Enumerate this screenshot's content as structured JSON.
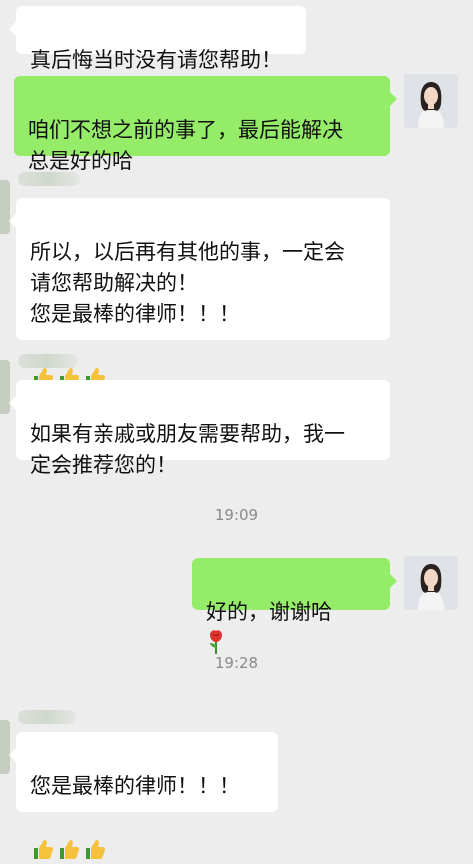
{
  "messages": [
    {
      "id": 1,
      "side": "left",
      "text": "真后悔当时没有请您帮助！"
    },
    {
      "id": 2,
      "side": "right",
      "text": "咱们不想之前的事了，最后能解决\n总是好的哈"
    },
    {
      "id": 3,
      "side": "left",
      "text": "所以，以后再有其他的事，一定会\n请您帮助解决的！\n您是最棒的律师！！！",
      "emoji": [
        "thumbs-up",
        "thumbs-up",
        "thumbs-up"
      ]
    },
    {
      "id": 4,
      "side": "left",
      "text": "如果有亲戚或朋友需要帮助，我一\n定会推荐您的！"
    },
    {
      "id": 5,
      "side": "right",
      "text": "好的，谢谢哈",
      "emoji": [
        "rose"
      ]
    },
    {
      "id": 6,
      "side": "left",
      "text": "您是最棒的律师！！！",
      "emoji": [
        "thumbs-up",
        "thumbs-up",
        "thumbs-up"
      ]
    }
  ],
  "timestamps": [
    "19:09",
    "19:28"
  ],
  "colors": {
    "background": "#ededed",
    "incoming_bubble": "#ffffff",
    "outgoing_bubble": "#95ec69",
    "timestamp_text": "#8a8a8a"
  },
  "icons": {
    "sender_avatar": "avatar-woman-icon",
    "thumbs": "thumbs-up-icon",
    "rose": "rose-icon"
  }
}
